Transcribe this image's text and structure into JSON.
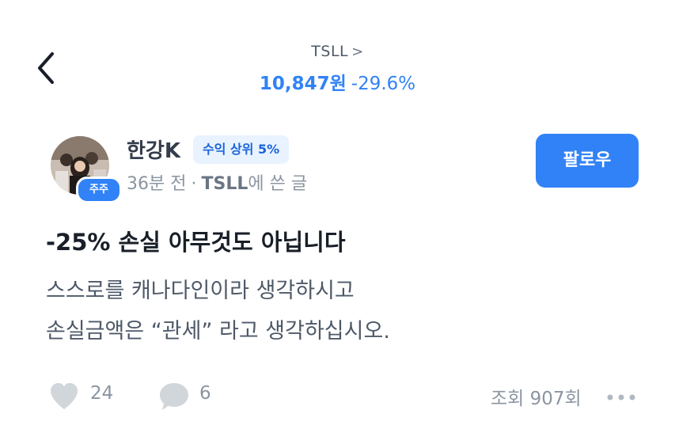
{
  "header": {
    "ticker": "TSLL",
    "chevron": ">",
    "price": "10,847원",
    "change": "-29.6%",
    "accent_color": "#3182f6"
  },
  "author": {
    "avatar_badge": "주주",
    "name": "한강K",
    "rank_badge": "수익 상위 5%",
    "time": "36분 전",
    "separator": "·",
    "board": "TSLL",
    "board_suffix": "에 쓴 글",
    "follow_label": "팔로우"
  },
  "post": {
    "title": "-25% 손실 아무것도 아닙니다",
    "body_lines": [
      "스스로를 캐나다인이라 생각하시고",
      "손실금액은 “관세” 라고 생각하십시오."
    ]
  },
  "footer": {
    "likes": "24",
    "comments": "6",
    "views": "조회 907회",
    "icons": [
      "heart-icon",
      "comment-icon",
      "more-icon"
    ]
  }
}
